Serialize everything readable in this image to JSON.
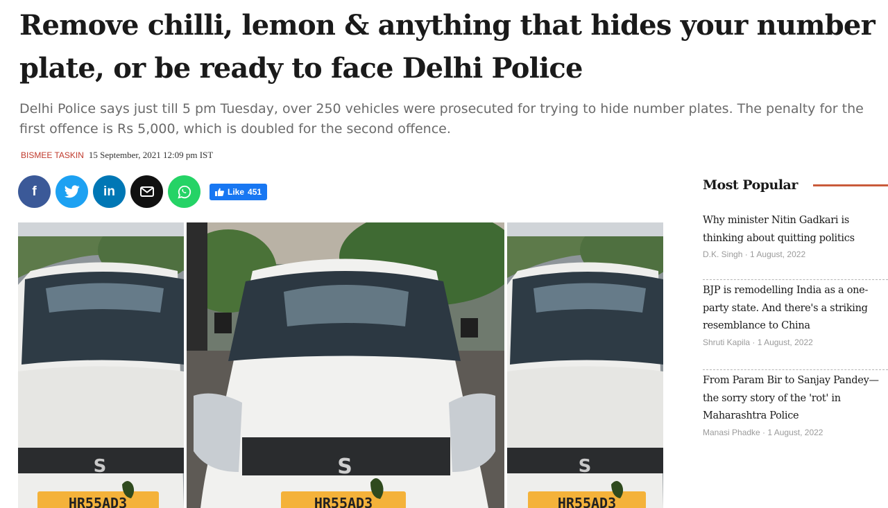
{
  "article": {
    "headline": "Remove chilli, lemon & anything that hides your number plate, or be ready to face Delhi Police",
    "standfirst": "Delhi Police says just till 5 pm Tuesday, over 250 vehicles were prosecuted for trying to hide number plates. The penalty for the first offence is Rs 5,000, which is doubled for the second offence.",
    "author": "Bismee Taskin",
    "date": "15 September, 2021 12:09 pm IST"
  },
  "share": {
    "buttons": [
      {
        "name": "facebook",
        "glyph": "f",
        "color": "#3b5998"
      },
      {
        "name": "twitter",
        "glyph": "",
        "color": "#1da1f2"
      },
      {
        "name": "linkedin",
        "glyph": "in",
        "color": "#0077b5"
      },
      {
        "name": "email",
        "glyph": "",
        "color": "#111111"
      },
      {
        "name": "whatsapp",
        "glyph": "",
        "color": "#25d366"
      }
    ],
    "like_label": "Like",
    "like_count": "451",
    "like_color": "#1877f2"
  },
  "photo": {
    "plate_text": "HR55AD3",
    "panels": 3
  },
  "sidebar": {
    "title": "Most Popular",
    "accent": "#c95a3a",
    "items": [
      {
        "title": "Why minister Nitin Gadkari is thinking about quitting politics",
        "author": "D.K. Singh",
        "date": "1 August, 2022"
      },
      {
        "title": "BJP is remodelling India as a one-party state. And there's a striking resemblance to China",
        "author": "Shruti Kapila",
        "date": "1 August, 2022"
      },
      {
        "title": "From Param Bir to Sanjay Pandey—the sorry story of the 'rot' in Maharashtra Police",
        "author": "Manasi Phadke",
        "date": "1 August, 2022"
      }
    ]
  }
}
